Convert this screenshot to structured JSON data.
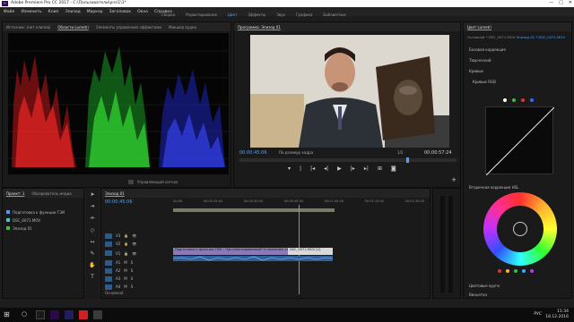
{
  "window": {
    "title": "Adobe Premiere Pro CC 2017 - C:\\Пользователи\\pro\\1\\1*",
    "app_icon": "Pr",
    "controls": [
      "—",
      "□",
      "✕"
    ]
  },
  "menu": [
    "Файл",
    "Изменить",
    "Клип",
    "Эпизод",
    "Маркер",
    "Заголовок",
    "Окно",
    "Справка"
  ],
  "workspaces": [
    "Сборка",
    "Редактирование",
    "Цвет",
    "Эффекты",
    "Звук",
    "Графика",
    "Библиотеки"
  ],
  "workspace_active_index": 2,
  "scopes": {
    "tabs": [
      "Источник: (нет клипов)",
      "Области Lumetri",
      "Элементы управления эффектами",
      "Микшер аудио"
    ],
    "active_tab": 1,
    "footer": "Управляющий сигнал"
  },
  "program": {
    "tab": "Программа: Эпизод 01",
    "timecode_left": "00:00:45:06",
    "fit_label": "По размеру кадра",
    "zoom": "1/2",
    "timecode_right": "00:00:57:24"
  },
  "lumetri": {
    "tab": "Цвет Lumetri",
    "clip_label": "Основной * DSC_0071.MOV",
    "clip_label_2": "Эпизод 01 * DSC_0071.MOV",
    "sections": [
      "Базовая коррекция",
      "Творческий",
      "Кривые",
      "Кривые RGB",
      "Цветовые круги",
      "Цветовой круг",
      "Виньетка"
    ],
    "hsl_label": "Вторичная коррекция HSL"
  },
  "project": {
    "tabs": [
      "Проект: 1",
      "Обозреватель медиа"
    ],
    "items": [
      "Подготовка к функции ГЭИ",
      "DSC_0071.MOV",
      "Эпизод 01"
    ]
  },
  "timeline": {
    "tab": "Эпизод 01",
    "timecode": "00:00:45:06",
    "ruler": [
      "00:00",
      "00:00:15:00",
      "00:00:30:00",
      "00:00:45:00",
      "00:01:00:00",
      "00:01:15:00",
      "00:01:30:00"
    ],
    "video_tracks": [
      "V3",
      "V2",
      "V1"
    ],
    "audio_tracks": [
      "A1",
      "A2",
      "A3",
      "A4"
    ],
    "clip_v1": "Подготовка к функции ГЭИ - \"Аргументированный\" и значения: сюрприз",
    "clip_v1_b": "DSC_0071.MOV [V]",
    "master": "Основной"
  },
  "taskbar": {
    "time": "11:34",
    "date": "18.12.2016",
    "lang": "РУС"
  }
}
